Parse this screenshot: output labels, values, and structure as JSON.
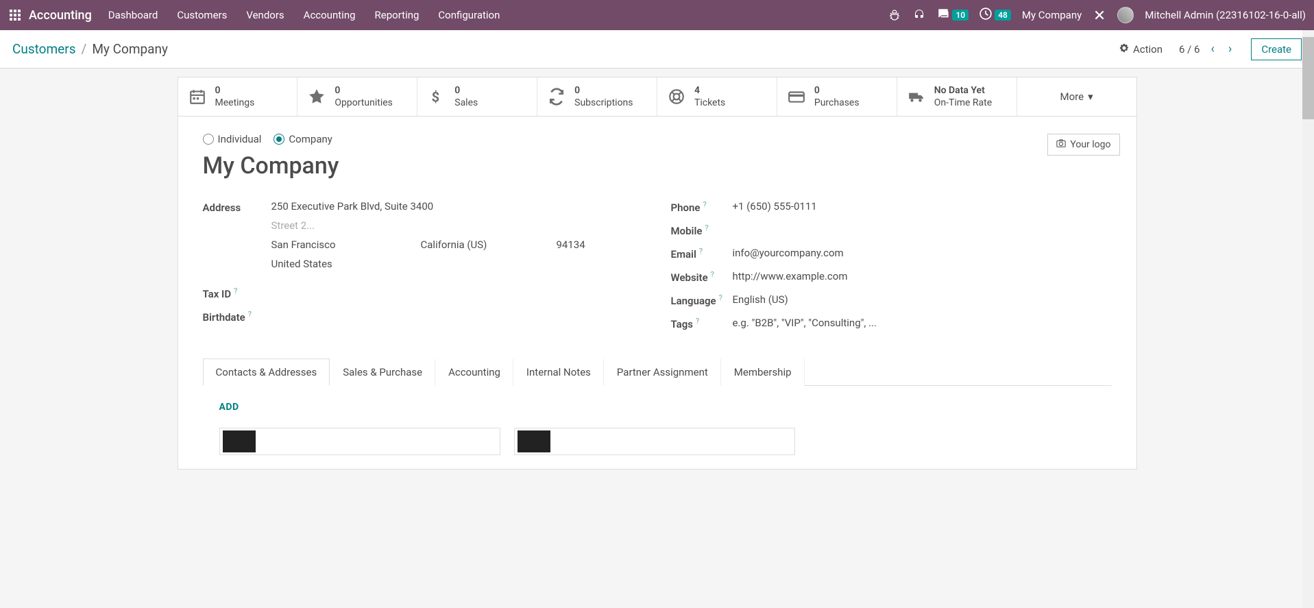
{
  "navbar": {
    "app_title": "Accounting",
    "menu": [
      "Dashboard",
      "Customers",
      "Vendors",
      "Accounting",
      "Reporting",
      "Configuration"
    ],
    "messages_count": "10",
    "activities_count": "48",
    "company": "My Company",
    "user": "Mitchell Admin (22316102-16-0-all)"
  },
  "controlbar": {
    "breadcrumb_root": "Customers",
    "breadcrumb_current": "My Company",
    "action_label": "Action",
    "pager": "6 / 6",
    "create_label": "Create"
  },
  "stats": {
    "meetings": {
      "count": "0",
      "label": "Meetings"
    },
    "opportunities": {
      "count": "0",
      "label": "Opportunities"
    },
    "sales": {
      "count": "0",
      "label": "Sales"
    },
    "subscriptions": {
      "count": "0",
      "label": "Subscriptions"
    },
    "tickets": {
      "count": "4",
      "label": "Tickets"
    },
    "purchases": {
      "count": "0",
      "label": "Purchases"
    },
    "ontime": {
      "count": "No Data Yet",
      "label": "On-Time Rate"
    },
    "more": "More"
  },
  "form": {
    "radio_individual": "Individual",
    "radio_company": "Company",
    "your_logo": "Your logo",
    "title": "My Company",
    "labels": {
      "address": "Address",
      "taxid": "Tax ID",
      "birthdate": "Birthdate",
      "phone": "Phone",
      "mobile": "Mobile",
      "email": "Email",
      "website": "Website",
      "language": "Language",
      "tags": "Tags"
    },
    "address": {
      "street": "250 Executive Park Blvd, Suite 3400",
      "street2_ph": "Street 2...",
      "city": "San Francisco",
      "state": "California (US)",
      "zip": "94134",
      "country": "United States"
    },
    "phone": "+1 (650) 555-0111",
    "email": "info@yourcompany.com",
    "website": "http://www.example.com",
    "language": "English (US)",
    "tags_ph": "e.g. \"B2B\", \"VIP\", \"Consulting\", ..."
  },
  "tabs": {
    "items": [
      "Contacts & Addresses",
      "Sales & Purchase",
      "Accounting",
      "Internal Notes",
      "Partner Assignment",
      "Membership"
    ],
    "add": "ADD"
  }
}
